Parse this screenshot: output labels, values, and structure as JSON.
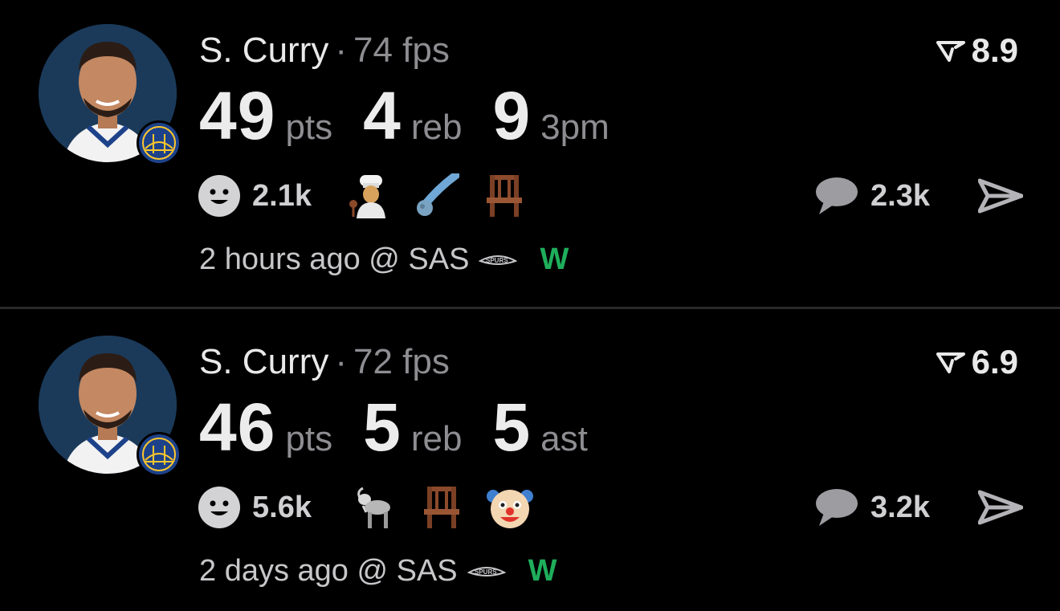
{
  "cards": [
    {
      "name": "S. Curry",
      "separator": "·",
      "fps": "74 fps",
      "rating": "8.9",
      "stats": [
        {
          "value": "49",
          "unit": "pts"
        },
        {
          "value": "4",
          "unit": "reb"
        },
        {
          "value": "9",
          "unit": "3pm"
        }
      ],
      "reaction_count": "2.1k",
      "emojis": [
        "chef-icon",
        "comet-icon",
        "chair-icon"
      ],
      "comment_count": "2.3k",
      "time": "2 hours ago @ SAS",
      "result": "W"
    },
    {
      "name": "S. Curry",
      "separator": "·",
      "fps": "72 fps",
      "rating": "6.9",
      "stats": [
        {
          "value": "46",
          "unit": "pts"
        },
        {
          "value": "5",
          "unit": "reb"
        },
        {
          "value": "5",
          "unit": "ast"
        }
      ],
      "reaction_count": "5.6k",
      "emojis": [
        "goat-icon",
        "chair-icon",
        "clown-face-icon"
      ],
      "comment_count": "3.2k",
      "time": "2 days ago @ SAS",
      "result": "W"
    }
  ],
  "colors": {
    "background": "#000000",
    "primary_text": "#e9e9ea",
    "secondary_text": "#8d8d92",
    "win": "#1fae5b",
    "divider": "#2a2a2c"
  }
}
